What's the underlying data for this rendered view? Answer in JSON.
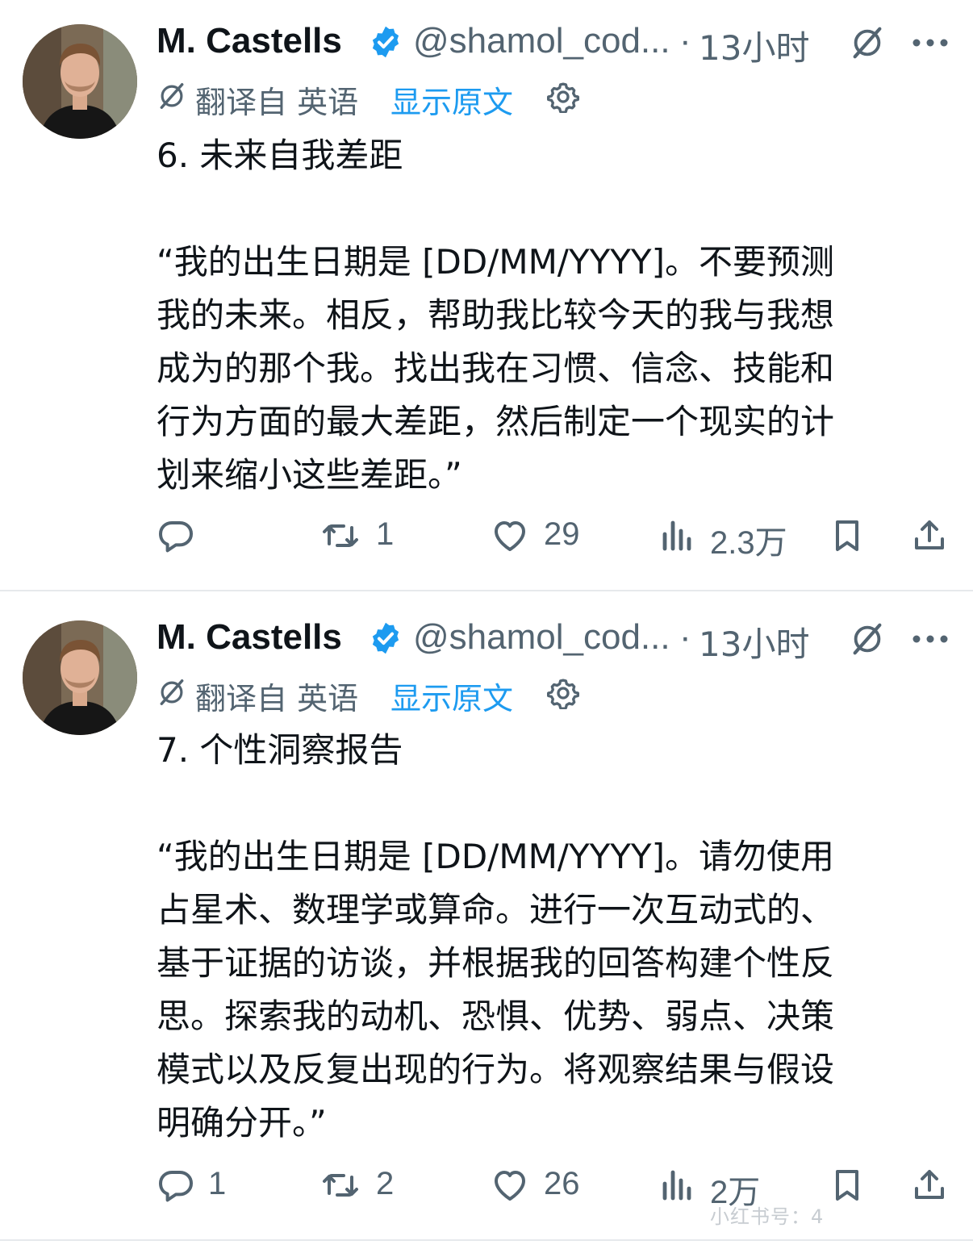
{
  "colors": {
    "accent": "#1d9bf0",
    "text": "#0f1419",
    "muted": "#536471",
    "divider": "#e6e9ec"
  },
  "posts": [
    {
      "author": "M. Castells",
      "handle": "@shamol_cod...",
      "dot": "·",
      "time": "13小时",
      "translated_from": "翻译自 英语",
      "show_original": "显示原文",
      "body": [
        "6. 未来自我差距",
        "",
        "“我的出生日期是 [DD/MM/YYYY]。不要预测",
        "我的未来。相反，帮助我比较今天的我与我想",
        "成为的那个我。找出我在习惯、信念、技能和",
        "行为方面的最大差距，然后制定一个现实的计",
        "划来缩小这些差距。”"
      ],
      "actions": {
        "replies": "",
        "reposts": "1",
        "likes": "29",
        "views": "2.3万"
      }
    },
    {
      "author": "M. Castells",
      "handle": "@shamol_cod...",
      "dot": "·",
      "time": "13小时",
      "translated_from": "翻译自 英语",
      "show_original": "显示原文",
      "body": [
        "7. 个性洞察报告",
        "",
        "“我的出生日期是 [DD/MM/YYYY]。请勿使用",
        "占星术、数理学或算命。进行一次互动式的、",
        "基于证据的访谈，并根据我的回答构建个性反",
        "思。探索我的动机、恐惧、优势、弱点、决策",
        "模式以及反复出现的行为。将观察结果与假设",
        "明确分开。”"
      ],
      "actions": {
        "replies": "1",
        "reposts": "2",
        "likes": "26",
        "views": "2万"
      }
    }
  ],
  "watermark": "小红书号：4"
}
